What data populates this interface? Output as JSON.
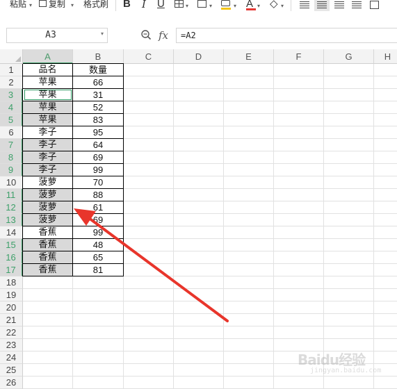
{
  "toolbar": {
    "paste_label": "粘贴",
    "copy_label": "复制",
    "format_painter_label": "格式刷",
    "bold_icon": "B",
    "italic_icon": "I",
    "underline_icon": "U",
    "font_color_icon": "A",
    "font_color": "#e53935",
    "fill_color": "#f5c518"
  },
  "formula_bar": {
    "name_box": "A3",
    "zoom_icon": "zoom-icon",
    "fx_label": "fx",
    "formula": "=A2"
  },
  "columns": [
    "A",
    "B",
    "C",
    "D",
    "E",
    "F",
    "G",
    "H"
  ],
  "selected_column": "A",
  "rows": [
    {
      "num": "1",
      "a": "品名",
      "b": "数量",
      "selected": false,
      "shade": false
    },
    {
      "num": "2",
      "a": "苹果",
      "b": "66",
      "selected": false,
      "shade": false
    },
    {
      "num": "3",
      "a": "苹果",
      "b": "31",
      "selected": true,
      "shade": false
    },
    {
      "num": "4",
      "a": "苹果",
      "b": "52",
      "selected": true,
      "shade": true
    },
    {
      "num": "5",
      "a": "苹果",
      "b": "83",
      "selected": true,
      "shade": true
    },
    {
      "num": "6",
      "a": "李子",
      "b": "95",
      "selected": false,
      "shade": false
    },
    {
      "num": "7",
      "a": "李子",
      "b": "64",
      "selected": true,
      "shade": true
    },
    {
      "num": "8",
      "a": "李子",
      "b": "69",
      "selected": true,
      "shade": true
    },
    {
      "num": "9",
      "a": "李子",
      "b": "99",
      "selected": true,
      "shade": true
    },
    {
      "num": "10",
      "a": "菠萝",
      "b": "70",
      "selected": false,
      "shade": false
    },
    {
      "num": "11",
      "a": "菠萝",
      "b": "88",
      "selected": true,
      "shade": true
    },
    {
      "num": "12",
      "a": "菠萝",
      "b": "61",
      "selected": true,
      "shade": true
    },
    {
      "num": "13",
      "a": "菠萝",
      "b": "69",
      "selected": true,
      "shade": true
    },
    {
      "num": "14",
      "a": "香蕉",
      "b": "99",
      "selected": false,
      "shade": false
    },
    {
      "num": "15",
      "a": "香蕉",
      "b": "48",
      "selected": true,
      "shade": true
    },
    {
      "num": "16",
      "a": "香蕉",
      "b": "65",
      "selected": true,
      "shade": true
    },
    {
      "num": "17",
      "a": "香蕉",
      "b": "81",
      "selected": true,
      "shade": true
    },
    {
      "num": "18",
      "a": "",
      "b": "",
      "selected": false,
      "shade": false
    },
    {
      "num": "19",
      "a": "",
      "b": "",
      "selected": false,
      "shade": false
    },
    {
      "num": "20",
      "a": "",
      "b": "",
      "selected": false,
      "shade": false
    },
    {
      "num": "21",
      "a": "",
      "b": "",
      "selected": false,
      "shade": false
    },
    {
      "num": "22",
      "a": "",
      "b": "",
      "selected": false,
      "shade": false
    },
    {
      "num": "23",
      "a": "",
      "b": "",
      "selected": false,
      "shade": false
    },
    {
      "num": "24",
      "a": "",
      "b": "",
      "selected": false,
      "shade": false
    },
    {
      "num": "25",
      "a": "",
      "b": "",
      "selected": false,
      "shade": false
    },
    {
      "num": "26",
      "a": "",
      "b": "",
      "selected": false,
      "shade": false
    }
  ],
  "annotation": {
    "arrow_color": "#e8352b"
  },
  "watermark": {
    "text": "Baidu经验",
    "sub": "jingyan.baidu.com"
  }
}
